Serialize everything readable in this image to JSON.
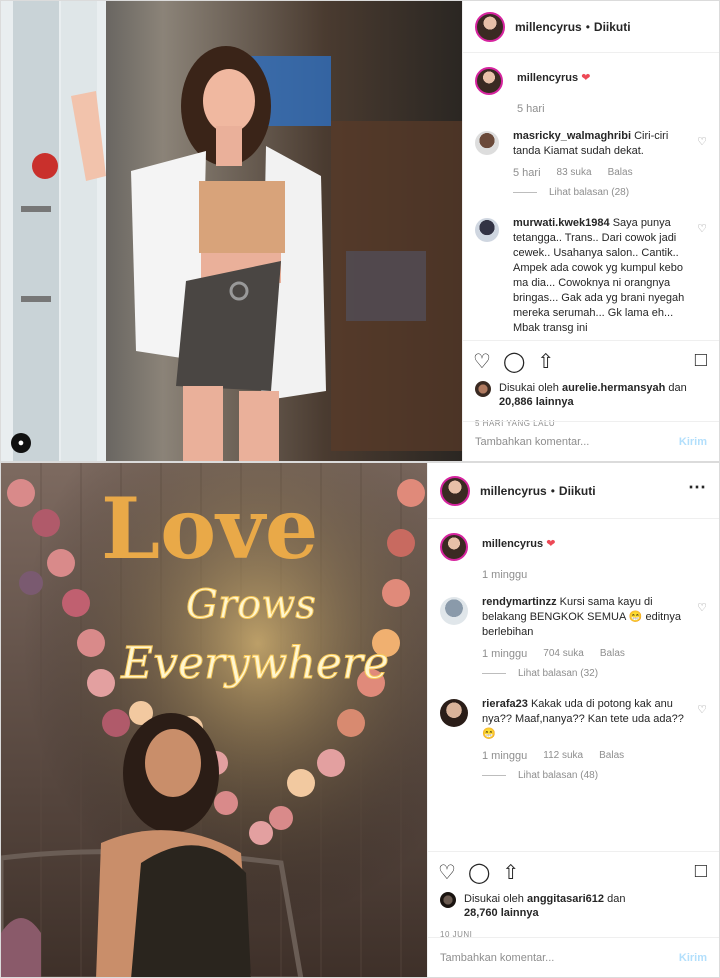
{
  "post1": {
    "username": "millencyrus",
    "dot": "•",
    "follow_state": "Diikuti",
    "owner_time": "5 hari",
    "comments": [
      {
        "user": "masricky_walmaghribi",
        "text": "Ciri-ciri tanda Kiamat sudah dekat.",
        "time": "5 hari",
        "likes": "83 suka",
        "reply": "Balas",
        "see_replies": "Lihat balasan (28)"
      },
      {
        "user": "murwati.kwek1984",
        "text": "Saya punya tetangga.. Trans.. Dari cowok jadi cewek.. Usahanya salon.. Cantik.. Ampek ada cowok yg kumpul kebo ma dia... Cowoknya ni orangnya bringas... Gak ada yg brani nyegah mereka serumah... Gk lama eh... Mbak transg ini"
      }
    ],
    "liked_by_prefix": "Disukai oleh",
    "liked_by_user": "aurelie.hermansyah",
    "liked_by_suffix": "dan",
    "liked_by_count": "20,886 lainnya",
    "date": "5 HARI YANG LALU",
    "add_comment_placeholder": "Tambahkan komentar...",
    "send_label": "Kirim"
  },
  "post2": {
    "username": "millencyrus",
    "dot": "•",
    "follow_state": "Diikuti",
    "owner_time": "1 minggu",
    "neon_line1": "Grows",
    "neon_line2": "Everywhere",
    "flower_word": "Love",
    "comments": [
      {
        "user": "rendymartinzz",
        "text": "Kursi sama kayu di belakang BENGKOK SEMUA 😁 editnya berlebihan",
        "time": "1 minggu",
        "likes": "704 suka",
        "reply": "Balas",
        "see_replies": "Lihat balasan (32)"
      },
      {
        "user": "rierafa23",
        "text": "Kakak uda di potong kak anu nya?? Maaf,nanya?? Kan tete uda ada??😁",
        "time": "1 minggu",
        "likes": "112 suka",
        "reply": "Balas",
        "see_replies": "Lihat balasan (48)"
      }
    ],
    "liked_by_prefix": "Disukai oleh",
    "liked_by_user": "anggitasari612",
    "liked_by_suffix": "dan",
    "liked_by_count": "28,760 lainnya",
    "date": "10 JUNI",
    "add_comment_placeholder": "Tambahkan komentar...",
    "send_label": "Kirim"
  },
  "icons": [
    "heart-icon",
    "comment-icon",
    "share-icon",
    "bookmark-icon",
    "more-icon",
    "user-tag-icon"
  ],
  "colors": {
    "story_ring": "#d6249f",
    "owner_heart": "#ed4956",
    "muted": "#8e8e8e",
    "send": "#b2dffc"
  }
}
